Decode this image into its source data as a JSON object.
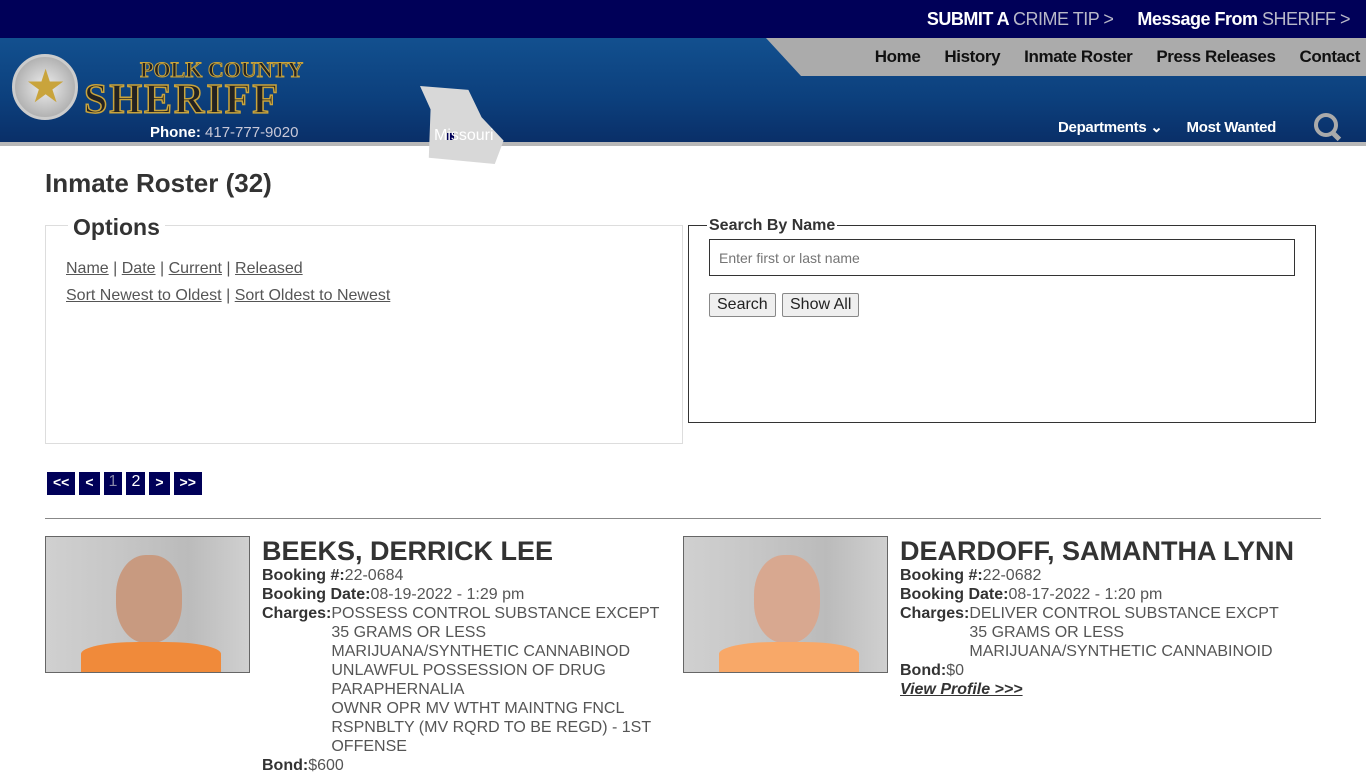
{
  "topbar": {
    "crime_tip_a": "SUBMIT A",
    "crime_tip_b": "CRIME TIP >",
    "message_a": "Message From",
    "message_b": "SHERIFF >"
  },
  "header": {
    "logo_text_1": "POLK COUNTY",
    "logo_text_2": "SHERIFF",
    "phone_label": "Phone:",
    "phone": "417-777-9020",
    "state": "Missouri"
  },
  "nav": {
    "main": [
      "Home",
      "History",
      "Inmate Roster",
      "Press Releases",
      "Contact"
    ],
    "departments": "Departments ⌄",
    "most_wanted": "Most Wanted",
    "search_icon": "search-icon"
  },
  "page": {
    "title": "Inmate Roster (32)"
  },
  "options": {
    "legend": "Options",
    "sort_links": [
      "Name",
      "Date",
      "Current",
      "Released"
    ],
    "order_links": [
      "Sort Newest to Oldest",
      "Sort Oldest to Newest"
    ],
    "sep": "|"
  },
  "search": {
    "legend": "Search By Name",
    "placeholder": "Enter first or last name",
    "value": "",
    "search_btn": "Search",
    "show_all_btn": "Show All"
  },
  "pager": {
    "first": "<<",
    "prev": "<",
    "pages": [
      "1",
      "2"
    ],
    "current": "1",
    "next": ">",
    "last": ">>"
  },
  "labels": {
    "booking_no": "Booking #:",
    "booking_date": "Booking Date:",
    "charges": "Charges:",
    "bond": "Bond:",
    "view_profile": "View Profile >>>"
  },
  "inmates": [
    {
      "name": "BEEKS, DERRICK LEE",
      "booking_no": "22-0684",
      "booking_date": "08-19-2022 - 1:29 pm",
      "charges": [
        "POSSESS CONTROL SUBSTANCE EXCEPT 35 GRAMS OR LESS MARIJUANA/SYNTHETIC CANNABINOD",
        "UNLAWFUL POSSESSION OF DRUG PARAPHERNALIA",
        "OWNR OPR MV WTHT MAINTNG FNCL RSPNBLTY (MV RQRD TO BE REGD) - 1ST OFFENSE"
      ],
      "bond": "$600"
    },
    {
      "name": "DEARDOFF, SAMANTHA LYNN",
      "booking_no": "22-0682",
      "booking_date": "08-17-2022 - 1:20 pm",
      "charges": [
        "DELIVER CONTROL SUBSTANCE EXCPT 35 GRAMS OR LESS MARIJUANA/SYNTHETIC CANNABINOID"
      ],
      "bond": "$0"
    }
  ]
}
